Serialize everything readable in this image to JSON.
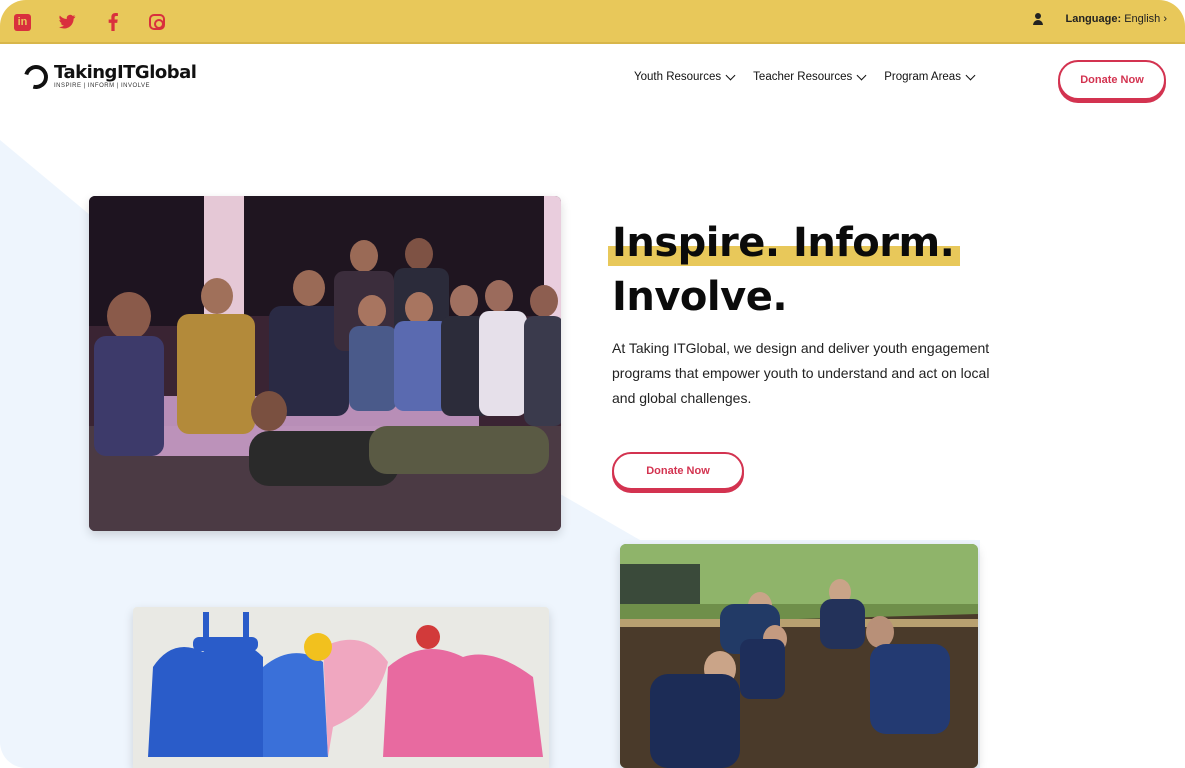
{
  "topbar": {
    "social_icons": [
      "linkedin-icon",
      "twitter-icon",
      "facebook-icon",
      "instagram-icon"
    ],
    "language_label": "Language:",
    "language_value": "English",
    "background_color": "#e8c85a"
  },
  "header": {
    "logo_name": "TakingITGlobal",
    "logo_tagline": "INSPIRE | INFORM | INVOLVE",
    "nav": [
      {
        "label": "Youth Resources"
      },
      {
        "label": "Teacher Resources"
      },
      {
        "label": "Program Areas"
      }
    ],
    "donate_label": "Donate Now"
  },
  "hero": {
    "headline_line1": "Inspire. Inform.",
    "headline_line2": "Involve.",
    "paragraph": "At Taking ITGlobal, we design and deliver youth engagement programs that empower youth to understand and act on local and global challenges.",
    "donate_label": "Donate Now"
  },
  "colors": {
    "accent_yellow": "#e8c85a",
    "accent_red": "#d33350",
    "bg_light_blue": "#eef5fd"
  }
}
